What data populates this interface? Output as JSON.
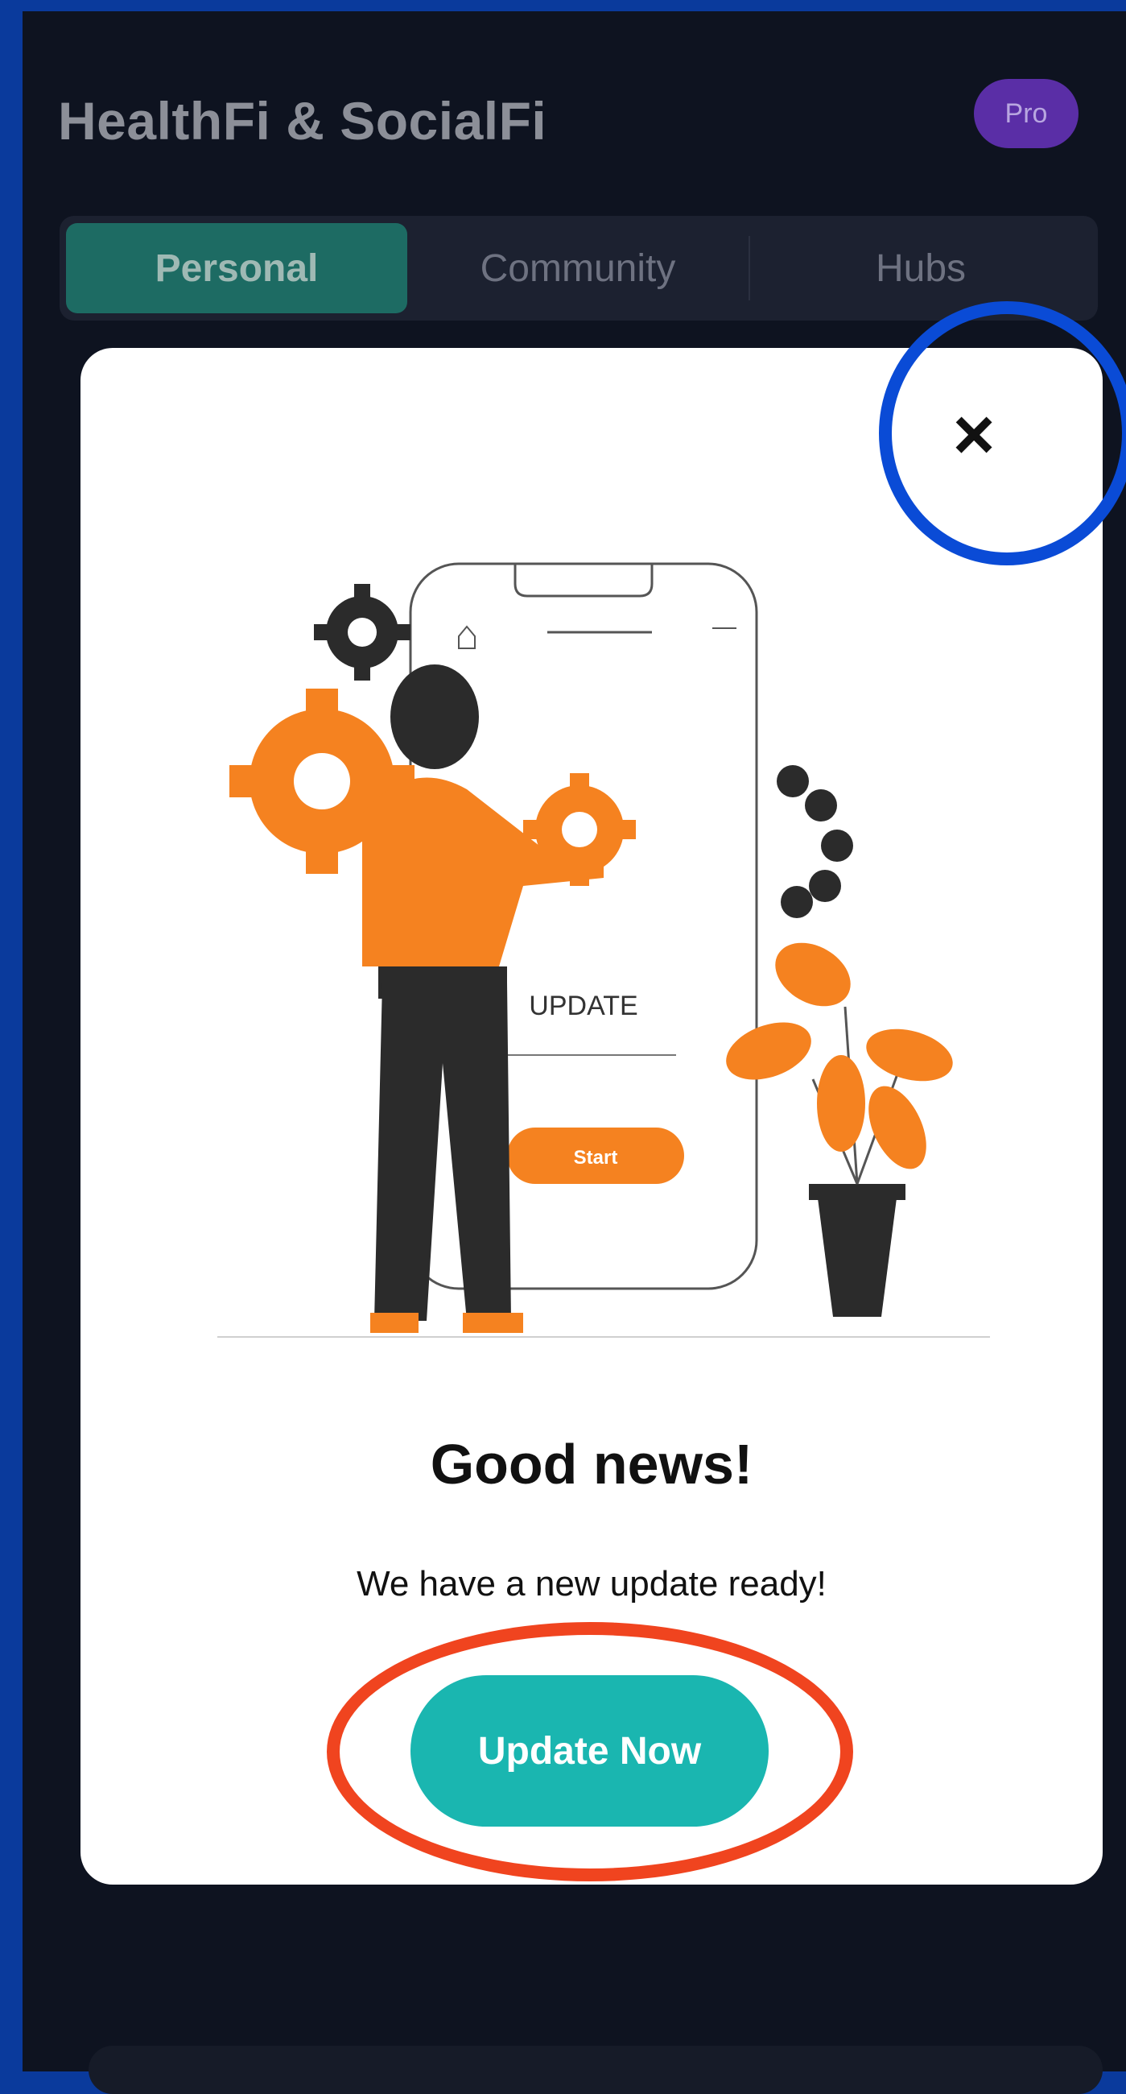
{
  "header": {
    "title": "HealthFi & SocialFi",
    "badge": "Pro"
  },
  "tabs": [
    {
      "label": "Personal",
      "active": true
    },
    {
      "label": "Community",
      "active": false
    },
    {
      "label": "Hubs",
      "active": false
    }
  ],
  "modal": {
    "close_icon": "close-icon",
    "illustration": {
      "screen_text": "UPDATE",
      "screen_button": "Start"
    },
    "heading": "Good news!",
    "message": "We have a new update ready!",
    "button_label": "Update Now"
  },
  "colors": {
    "accent": "#1ab6b0",
    "badge": "#5a2ea6",
    "active_tab": "#1d6b63",
    "annotation_blue": "#0a4bd6",
    "annotation_red": "#f0441f",
    "illustration_orange": "#f58220"
  }
}
